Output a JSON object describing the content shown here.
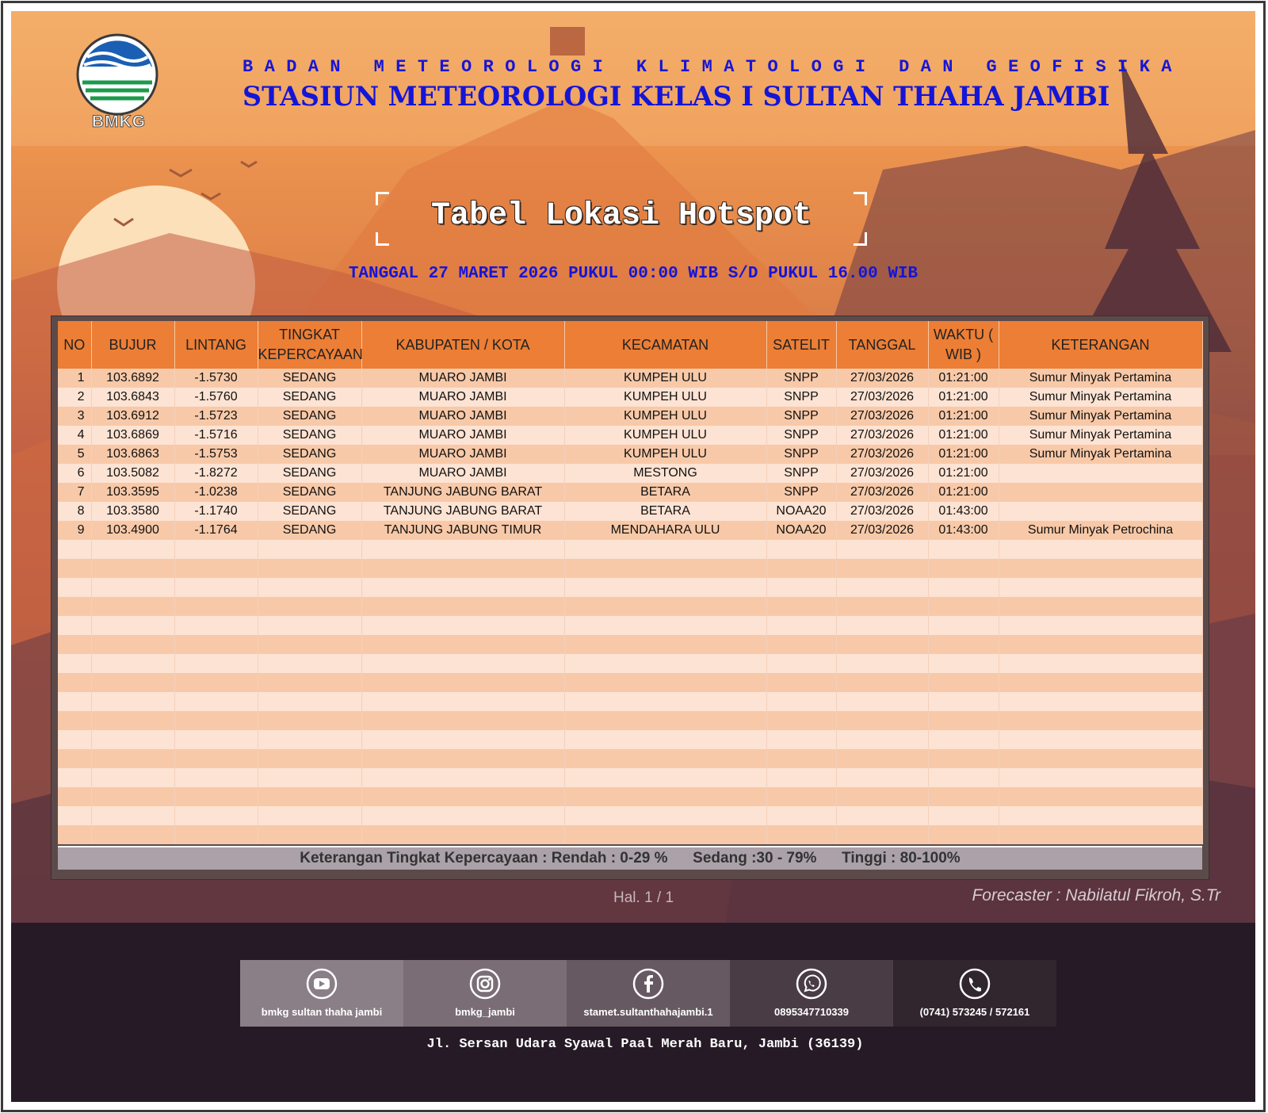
{
  "header": {
    "logo_text": "BMKG",
    "agency": "BADAN METEOROLOGI KLIMATOLOGI DAN GEOFISIKA",
    "station": "STASIUN METEOROLOGI KELAS I SULTAN THAHA JAMBI"
  },
  "title": "Tabel Lokasi Hotspot",
  "subtitle": "TANGGAL 27 MARET 2026 PUKUL 00:00 WIB S/D PUKUL 16.00 WIB",
  "table": {
    "headers": [
      "NO",
      "BUJUR",
      "LINTANG",
      "TINGKAT KEPERCAYAAN",
      "KABUPATEN / KOTA",
      "KECAMATAN",
      "SATELIT",
      "TANGGAL",
      "WAKTU ( WIB )",
      "KETERANGAN"
    ],
    "rows": [
      [
        "1",
        "103.6892",
        "-1.5730",
        "SEDANG",
        "MUARO JAMBI",
        "KUMPEH ULU",
        "SNPP",
        "27/03/2026",
        "01:21:00",
        "Sumur Minyak Pertamina"
      ],
      [
        "2",
        "103.6843",
        "-1.5760",
        "SEDANG",
        "MUARO JAMBI",
        "KUMPEH ULU",
        "SNPP",
        "27/03/2026",
        "01:21:00",
        "Sumur Minyak Pertamina"
      ],
      [
        "3",
        "103.6912",
        "-1.5723",
        "SEDANG",
        "MUARO JAMBI",
        "KUMPEH ULU",
        "SNPP",
        "27/03/2026",
        "01:21:00",
        "Sumur Minyak Pertamina"
      ],
      [
        "4",
        "103.6869",
        "-1.5716",
        "SEDANG",
        "MUARO JAMBI",
        "KUMPEH ULU",
        "SNPP",
        "27/03/2026",
        "01:21:00",
        "Sumur Minyak Pertamina"
      ],
      [
        "5",
        "103.6863",
        "-1.5753",
        "SEDANG",
        "MUARO JAMBI",
        "KUMPEH ULU",
        "SNPP",
        "27/03/2026",
        "01:21:00",
        "Sumur Minyak Pertamina"
      ],
      [
        "6",
        "103.5082",
        "-1.8272",
        "SEDANG",
        "MUARO JAMBI",
        "MESTONG",
        "SNPP",
        "27/03/2026",
        "01:21:00",
        ""
      ],
      [
        "7",
        "103.3595",
        "-1.0238",
        "SEDANG",
        "TANJUNG JABUNG BARAT",
        "BETARA",
        "SNPP",
        "27/03/2026",
        "01:21:00",
        ""
      ],
      [
        "8",
        "103.3580",
        "-1.1740",
        "SEDANG",
        "TANJUNG JABUNG BARAT",
        "BETARA",
        "NOAA20",
        "27/03/2026",
        "01:43:00",
        ""
      ],
      [
        "9",
        "103.4900",
        "-1.1764",
        "SEDANG",
        "TANJUNG JABUNG TIMUR",
        "MENDAHARA ULU",
        "NOAA20",
        "27/03/2026",
        "01:43:00",
        "Sumur Minyak Petrochina"
      ]
    ]
  },
  "legend": "Keterangan Tingkat Kepercayaan : Rendah : 0-29 %      Sedang :30 - 79%      Tinggi : 80-100%",
  "page_info": "Hal. 1 / 1",
  "forecaster": "Forecaster : Nabilatul Fikroh, S.Tr",
  "socials": [
    {
      "icon": "youtube-icon",
      "label": "bmkg sultan thaha jambi",
      "color": "#8a7f86"
    },
    {
      "icon": "instagram-icon",
      "label": "bmkg_jambi",
      "color": "#7a6d75"
    },
    {
      "icon": "facebook-icon",
      "label": "stamet.sultanthahajambi.1",
      "color": "#675961"
    },
    {
      "icon": "whatsapp-icon",
      "label": "0895347710339",
      "color": "#4a3c45"
    },
    {
      "icon": "phone-icon",
      "label": "(0741) 573245 / 572161",
      "color": "#31262e"
    }
  ],
  "address": "Jl. Sersan Udara Syawal Paal Merah Baru, Jambi (36139)",
  "colors": {
    "header_text": "#1515d8",
    "table_header": "#ec7e35",
    "row_odd": "#f8c9a8",
    "row_even": "#fde3d3"
  }
}
